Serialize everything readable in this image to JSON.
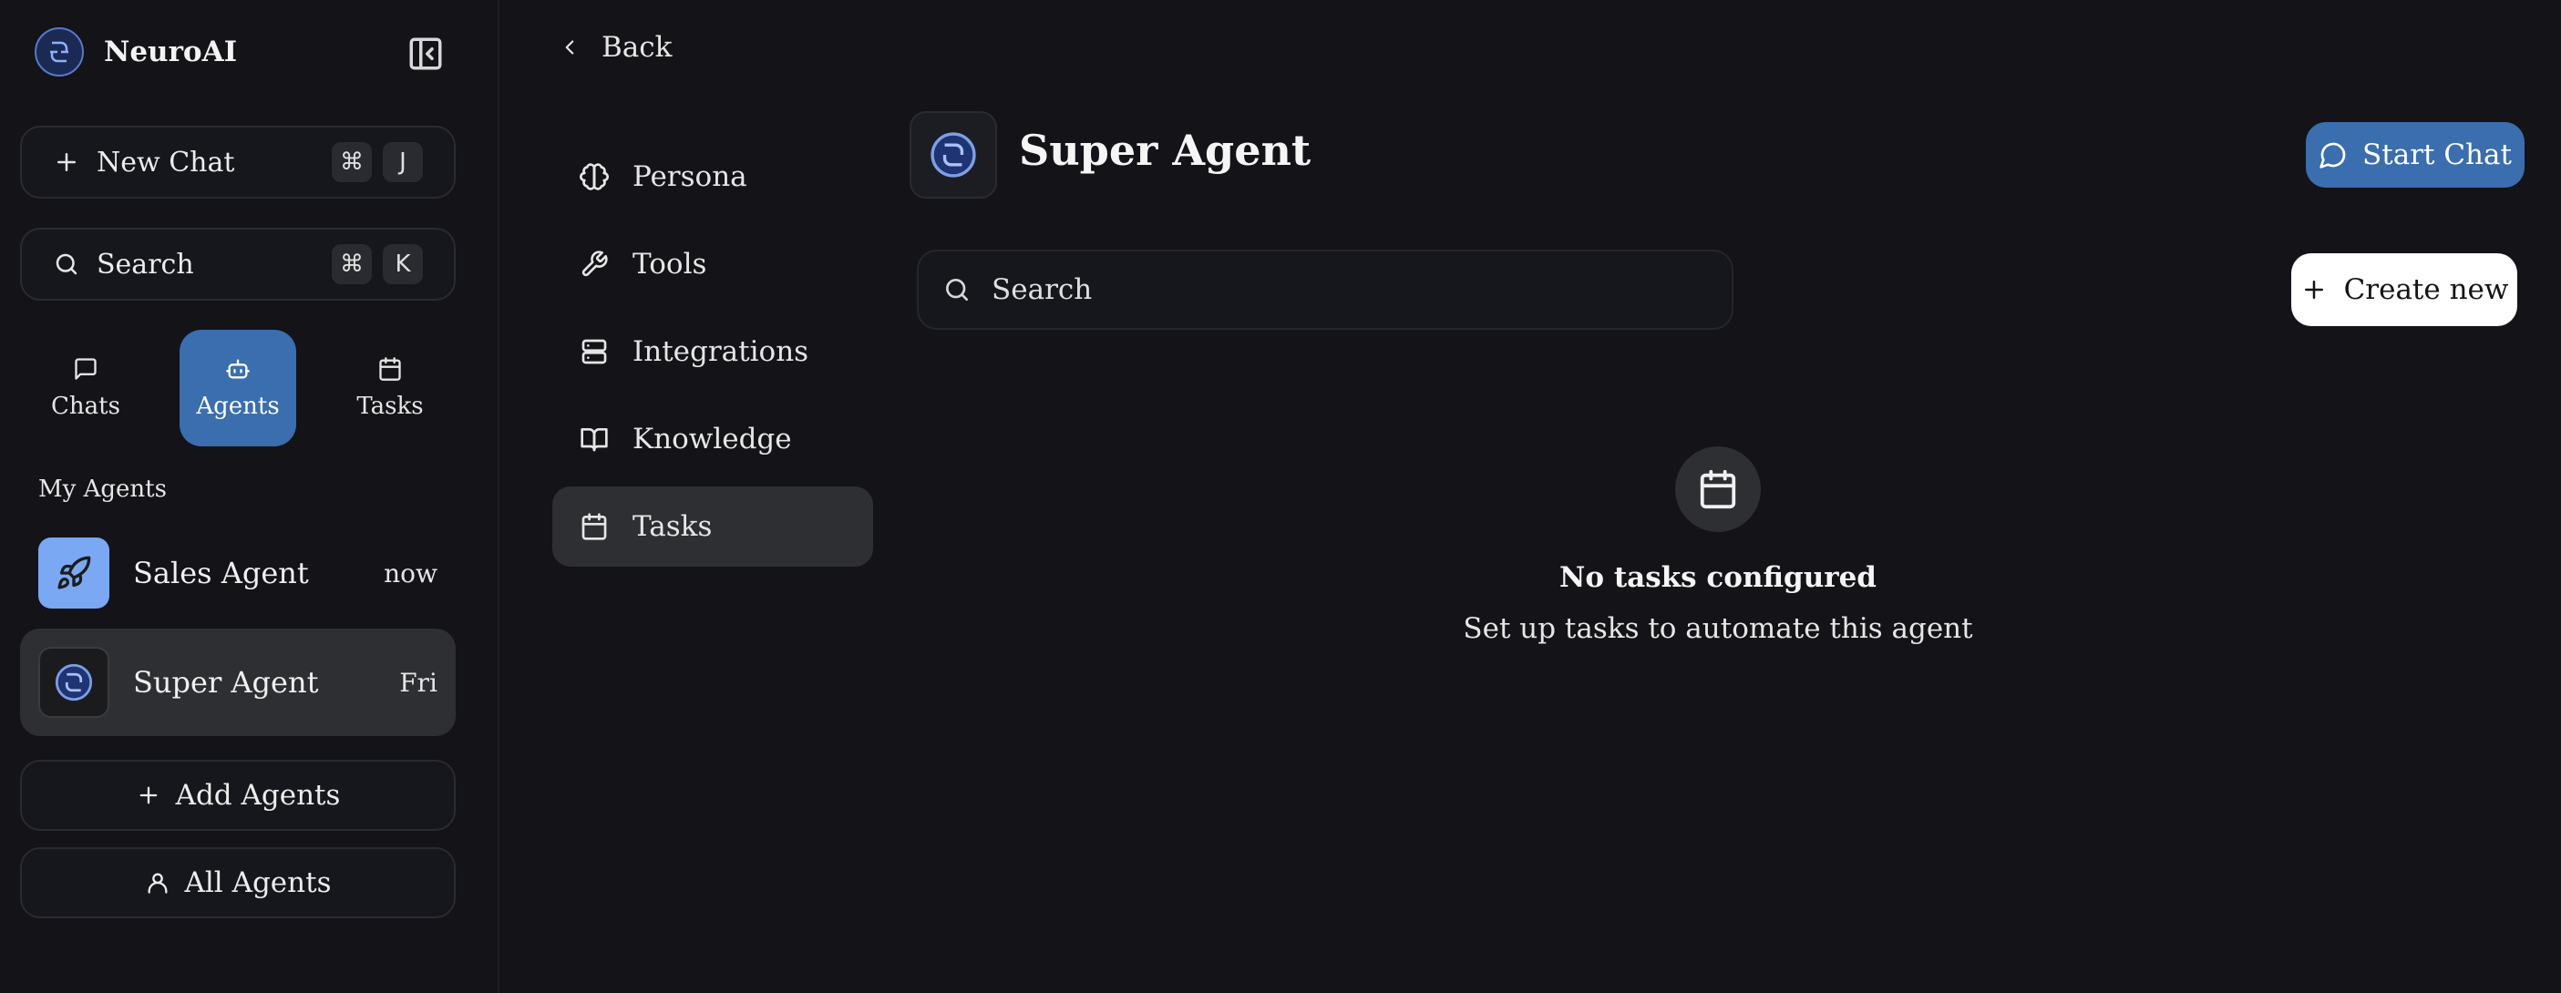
{
  "brand": {
    "name": "NeuroAI",
    "icon": "neuroai-logo"
  },
  "sidebar": {
    "new_chat": {
      "label": "New Chat",
      "keys": [
        "⌘",
        "J"
      ],
      "icon": "plus-icon"
    },
    "search": {
      "label": "Search",
      "keys": [
        "⌘",
        "K"
      ],
      "icon": "search-icon"
    },
    "modes": [
      {
        "label": "Chats",
        "icon": "message-square-icon",
        "active": false
      },
      {
        "label": "Agents",
        "icon": "bot-icon",
        "active": true
      },
      {
        "label": "Tasks",
        "icon": "calendar-icon",
        "active": false
      }
    ],
    "section_title": "My Agents",
    "agents": [
      {
        "name": "Sales Agent",
        "time": "now",
        "icon": "rocket-icon",
        "avatar_color": "#7aa8f2",
        "active": false
      },
      {
        "name": "Super Agent",
        "time": "Fri",
        "icon": "neuroai-logo",
        "avatar_color": "#1b1b1e",
        "active": true
      }
    ],
    "add_agents": "Add Agents",
    "all_agents": "All Agents"
  },
  "subnav": {
    "back_label": "Back",
    "items": [
      {
        "label": "Persona",
        "icon": "brain-icon",
        "active": false
      },
      {
        "label": "Tools",
        "icon": "wrench-icon",
        "active": false
      },
      {
        "label": "Integrations",
        "icon": "server-icon",
        "active": false
      },
      {
        "label": "Knowledge",
        "icon": "book-open-icon",
        "active": false
      },
      {
        "label": "Tasks",
        "icon": "calendar-icon",
        "active": true
      }
    ]
  },
  "main": {
    "title": "Super Agent",
    "start_chat": "Start Chat",
    "search_placeholder": "Search",
    "create_new": "Create new",
    "empty_title": "No tasks configured",
    "empty_subtitle": "Set up tasks to automate this agent"
  },
  "colors": {
    "background": "#131318",
    "accent": "#3a6eae",
    "active_item": "#2e2f33"
  }
}
